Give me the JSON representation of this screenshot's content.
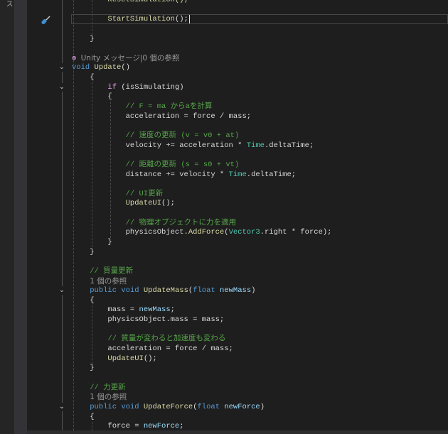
{
  "side_panel": {
    "label": "ス"
  },
  "editor": {
    "current_line": 2,
    "fold_lines": [
      7,
      9,
      30,
      42
    ],
    "lines": [
      [
        [
          "        ResetSimulation();",
          "fn"
        ]
      ],
      [],
      [
        [
          "        ",
          ""
        ],
        [
          "StartSimulation",
          "fn"
        ],
        [
          "();",
          ""
        ]
      ],
      [],
      [
        [
          "    }",
          ""
        ]
      ],
      [],
      [
        [
          "⊕ ",
          "ctl"
        ],
        [
          "Unity メッセージ|0 個の参照",
          "lens"
        ]
      ],
      [
        [
          "void",
          "kw"
        ],
        [
          " ",
          ""
        ],
        [
          "Update",
          "fn"
        ],
        [
          "()",
          ""
        ]
      ],
      [
        [
          "    {",
          ""
        ]
      ],
      [
        [
          "        ",
          ""
        ],
        [
          "if",
          "ctl"
        ],
        [
          " (isSimulating)",
          ""
        ]
      ],
      [
        [
          "        {",
          ""
        ]
      ],
      [
        [
          "            ",
          ""
        ],
        [
          "// F = ma からaを計算",
          "cm"
        ]
      ],
      [
        [
          "            acceleration = force / mass;",
          ""
        ]
      ],
      [],
      [
        [
          "            ",
          ""
        ],
        [
          "// 速度の更新 (v = v0 + at)",
          "cm"
        ]
      ],
      [
        [
          "            velocity += acceleration * ",
          ""
        ],
        [
          "Time",
          "ty"
        ],
        [
          ".deltaTime;",
          ""
        ]
      ],
      [],
      [
        [
          "            ",
          ""
        ],
        [
          "// 距離の更新 (s = s0 + vt)",
          "cm"
        ]
      ],
      [
        [
          "            distance += velocity * ",
          ""
        ],
        [
          "Time",
          "ty"
        ],
        [
          ".deltaTime;",
          ""
        ]
      ],
      [],
      [
        [
          "            ",
          ""
        ],
        [
          "// UI更新",
          "cm"
        ]
      ],
      [
        [
          "            ",
          ""
        ],
        [
          "UpdateUI",
          "fn"
        ],
        [
          "();",
          ""
        ]
      ],
      [],
      [
        [
          "            ",
          ""
        ],
        [
          "// 物理オブジェクトに力を適用",
          "cm"
        ]
      ],
      [
        [
          "            physicsObject.",
          ""
        ],
        [
          "AddForce",
          "fn"
        ],
        [
          "(",
          ""
        ],
        [
          "Vector3",
          "ty"
        ],
        [
          ".right * force);",
          ""
        ]
      ],
      [
        [
          "        }",
          ""
        ]
      ],
      [
        [
          "    }",
          ""
        ]
      ],
      [],
      [
        [
          "    ",
          ""
        ],
        [
          "// 質量更新",
          "cm"
        ]
      ],
      [
        [
          "    ",
          ""
        ],
        [
          "1 個の参照",
          "lens"
        ]
      ],
      [
        [
          "    ",
          ""
        ],
        [
          "public",
          "kw"
        ],
        [
          " ",
          ""
        ],
        [
          "void",
          "kw"
        ],
        [
          " ",
          ""
        ],
        [
          "UpdateMass",
          "fn"
        ],
        [
          "(",
          ""
        ],
        [
          "float",
          "kw"
        ],
        [
          " ",
          ""
        ],
        [
          "newMass",
          "pr"
        ],
        [
          ")",
          ""
        ]
      ],
      [
        [
          "    {",
          ""
        ]
      ],
      [
        [
          "        mass = ",
          ""
        ],
        [
          "newMass",
          "pr"
        ],
        [
          ";",
          ""
        ]
      ],
      [
        [
          "        physicsObject.mass = mass;",
          ""
        ]
      ],
      [],
      [
        [
          "        ",
          ""
        ],
        [
          "// 質量が変わると加速度も変わる",
          "cm"
        ]
      ],
      [
        [
          "        acceleration = force / mass;",
          ""
        ]
      ],
      [
        [
          "        ",
          ""
        ],
        [
          "UpdateUI",
          "fn"
        ],
        [
          "();",
          ""
        ]
      ],
      [
        [
          "    }",
          ""
        ]
      ],
      [],
      [
        [
          "    ",
          ""
        ],
        [
          "// 力更新",
          "cm"
        ]
      ],
      [
        [
          "    ",
          ""
        ],
        [
          "1 個の参照",
          "lens"
        ]
      ],
      [
        [
          "    ",
          ""
        ],
        [
          "public",
          "kw"
        ],
        [
          " ",
          ""
        ],
        [
          "void",
          "kw"
        ],
        [
          " ",
          ""
        ],
        [
          "UpdateForce",
          "fn"
        ],
        [
          "(",
          ""
        ],
        [
          "float",
          "kw"
        ],
        [
          " ",
          ""
        ],
        [
          "newForce",
          "pr"
        ],
        [
          ")",
          ""
        ]
      ],
      [
        [
          "    {",
          ""
        ]
      ],
      [
        [
          "        force = ",
          ""
        ],
        [
          "newForce",
          "pr"
        ],
        [
          ";",
          ""
        ]
      ]
    ]
  }
}
